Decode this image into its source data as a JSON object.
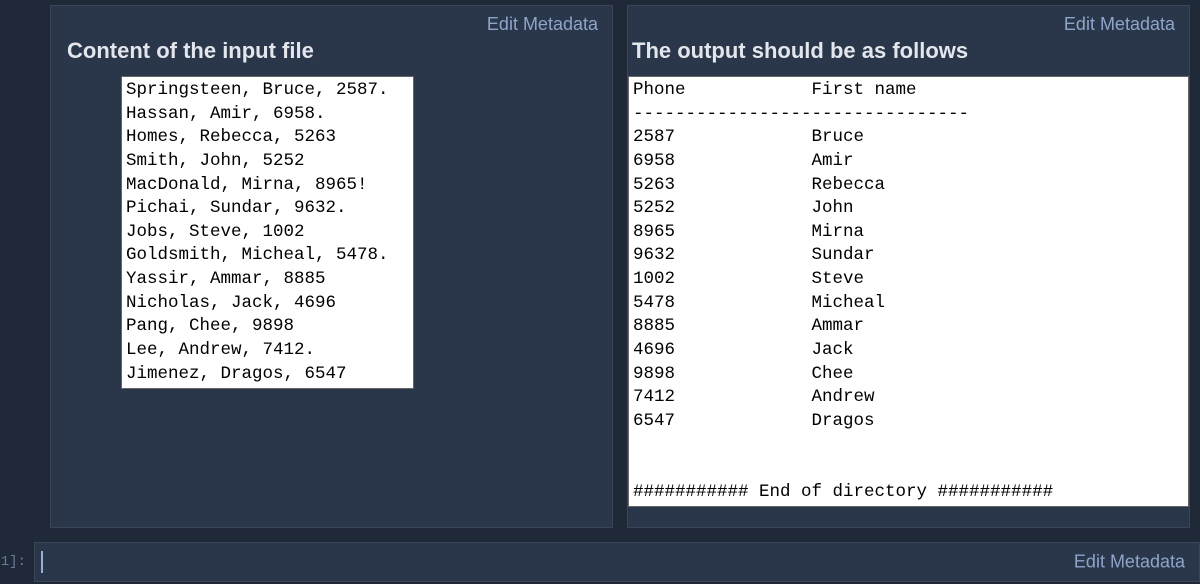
{
  "labels": {
    "edit_metadata": "Edit Metadata",
    "prompt": "1]:"
  },
  "left_cell": {
    "heading": "Content of the input file",
    "content": "Springsteen, Bruce, 2587.\nHassan, Amir, 6958.\nHomes, Rebecca, 5263\nSmith, John, 5252\nMacDonald, Mirna, 8965!\nPichai, Sundar, 9632.\nJobs, Steve, 1002\nGoldsmith, Micheal, 5478.\nYassir, Ammar, 8885\nNicholas, Jack, 4696\nPang, Chee, 9898\nLee, Andrew, 7412.\nJimenez, Dragos, 6547"
  },
  "right_cell": {
    "heading": "The output should be as follows",
    "content": "Phone            First name\n--------------------------------\n2587             Bruce\n6958             Amir\n5263             Rebecca\n5252             John\n8965             Mirna\n9632             Sundar\n1002             Steve\n5478             Micheal\n8885             Ammar\n4696             Jack\n9898             Chee\n7412             Andrew\n6547             Dragos\n\n\n########### End of directory ###########"
  }
}
